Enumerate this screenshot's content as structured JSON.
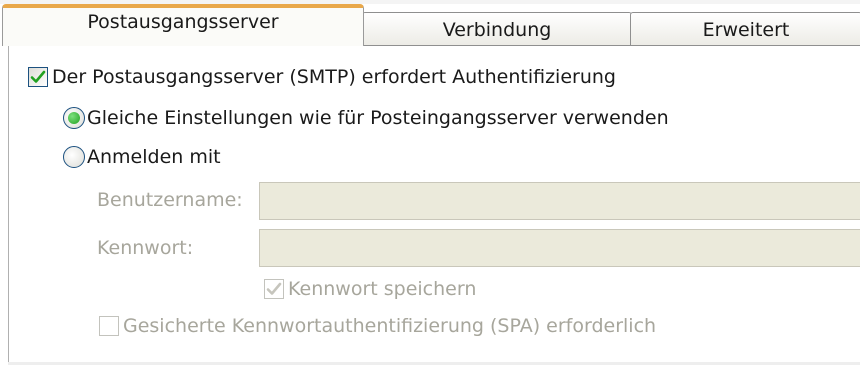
{
  "tabs": [
    {
      "label": "Postausgangsserver",
      "active": true
    },
    {
      "label": "Verbindung",
      "active": false
    },
    {
      "label": "Erweitert",
      "active": false
    }
  ],
  "auth_required": {
    "label": "Der Postausgangsserver (SMTP) erfordert Authentifizierung",
    "checked": true
  },
  "same_settings": {
    "label": "Gleiche Einstellungen wie für Posteingangsserver verwenden",
    "selected": true
  },
  "login_with": {
    "label": "Anmelden mit",
    "selected": false
  },
  "username": {
    "label": "Benutzername:",
    "value": "",
    "disabled": true
  },
  "password": {
    "label": "Kennwort:",
    "value": "",
    "disabled": true
  },
  "save_password": {
    "label": "Kennwort speichern",
    "checked": true,
    "disabled": true
  },
  "spa": {
    "label": "Gesicherte Kennwortauthentifizierung (SPA) erforderlich",
    "checked": false,
    "disabled": true
  },
  "colors": {
    "active_tab_accent": "#e9a84a",
    "check_green": "#21a121",
    "disabled_text": "#a7a69c",
    "disabled_field": "#ebeadb"
  }
}
